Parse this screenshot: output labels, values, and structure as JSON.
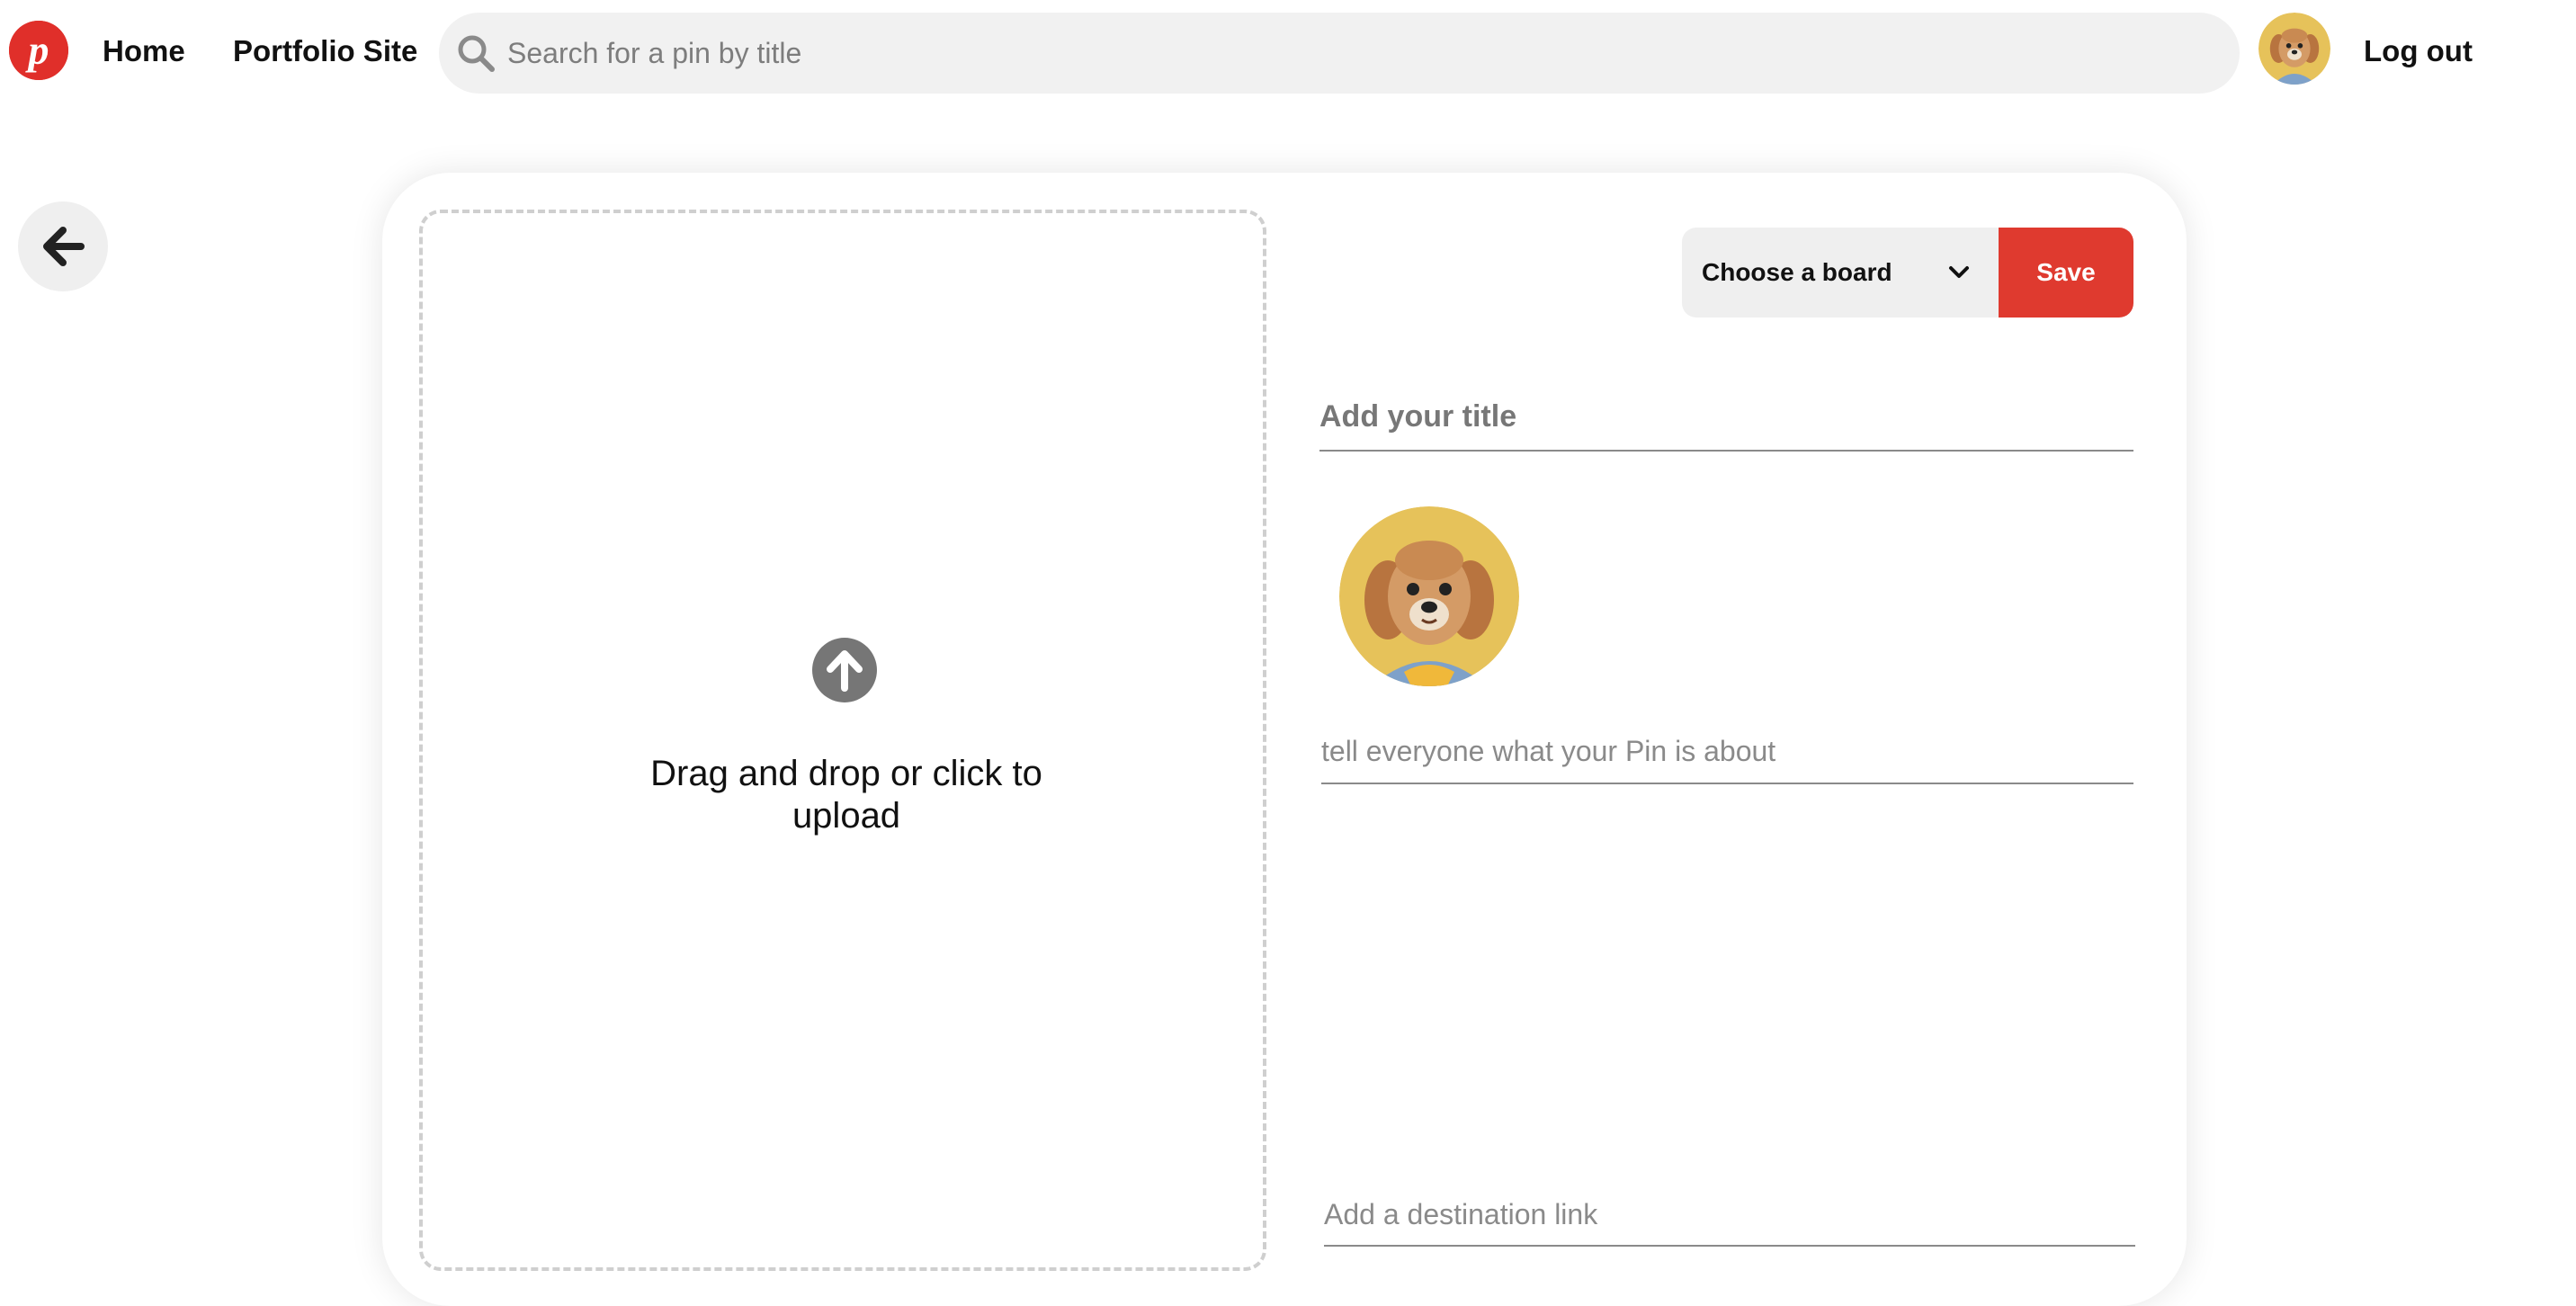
{
  "header": {
    "logo_icon": "pinterest-p-logo",
    "nav": {
      "home": "Home",
      "portfolio": "Portfolio Site"
    },
    "search": {
      "placeholder": "Search for a pin by title",
      "icon": "search-icon"
    },
    "avatar_icon": "dog-avatar",
    "logout": "Log out"
  },
  "back_button": {
    "icon": "arrow-left-icon"
  },
  "upload": {
    "icon": "arrow-up-circle-icon",
    "text": "Drag and drop or click to upload"
  },
  "board": {
    "selected": "Choose a board",
    "icon": "chevron-down-icon",
    "save_label": "Save"
  },
  "form": {
    "title_placeholder": "Add your title",
    "description_placeholder": "tell everyone what your Pin is about",
    "link_placeholder": "Add a destination link"
  },
  "colors": {
    "brand_red": "#e02f2a",
    "save_red": "#df3a2f",
    "avatar_bg": "#e6c25a"
  }
}
